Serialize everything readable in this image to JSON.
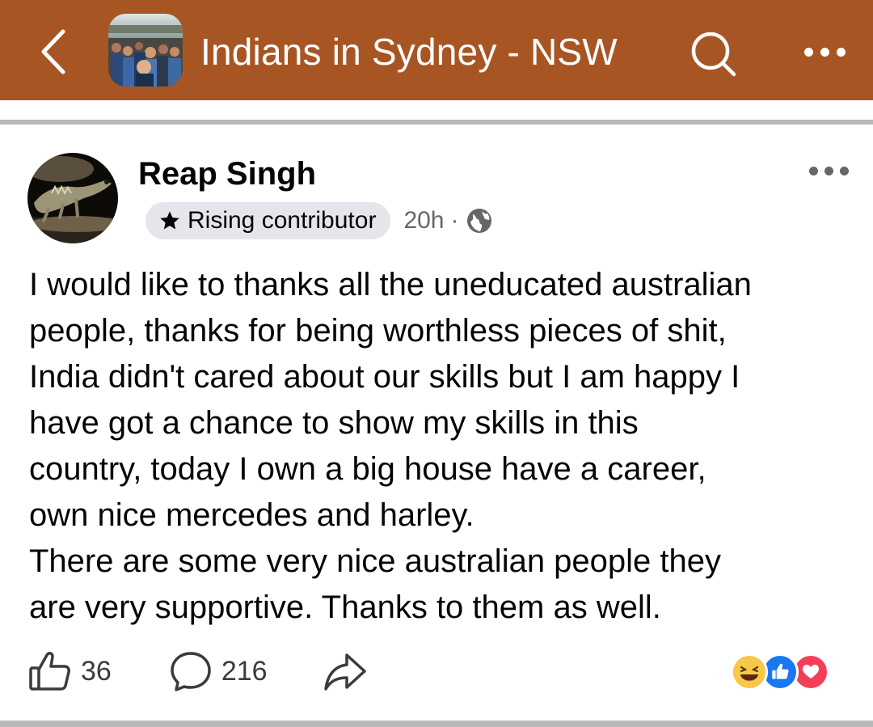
{
  "header": {
    "back_icon": "chevron-left-icon",
    "group_name": "Indians in Sydney - NSW",
    "search_icon": "search-icon",
    "more_icon": "more-horizontal-icon",
    "bar_color": "#a85524"
  },
  "post": {
    "author": "Reap Singh",
    "badge": "Rising contributor",
    "badge_icon": "star-icon",
    "time": "20h",
    "separator": "·",
    "privacy_icon": "globe-icon",
    "lines": [
      "I would like to thanks all the uneducated australian",
      "people, thanks for being worthless pieces of shit,",
      "India didn't cared about our skills but I am happy I",
      "have got a chance to show my skills in this",
      "country, today I own a big house have a career,",
      "own nice mercedes and harley.",
      "There are some very nice australian people they",
      "are very supportive. Thanks to them as well."
    ],
    "likes": "36",
    "comments": "216",
    "reactions": [
      "haha-reaction-icon",
      "like-reaction-icon",
      "love-reaction-icon"
    ]
  }
}
